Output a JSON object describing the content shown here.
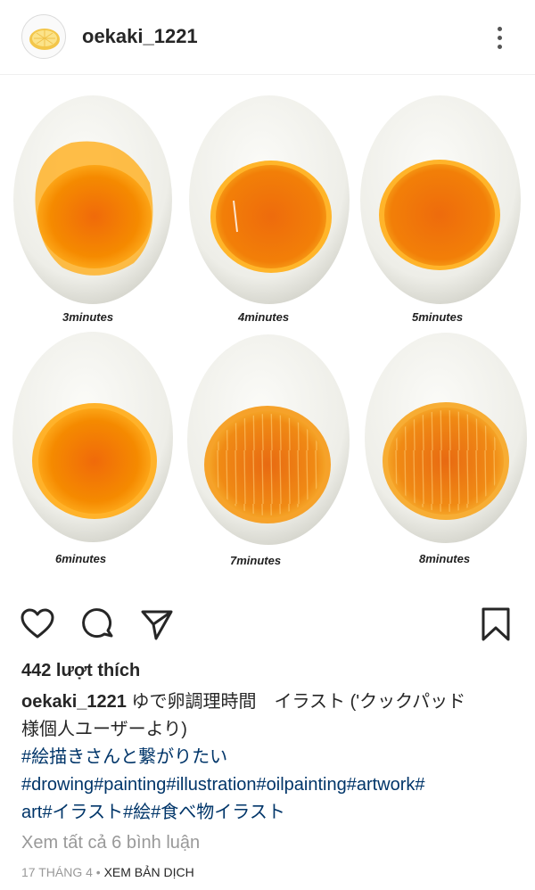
{
  "post": {
    "username": "oekaki_1221",
    "avatar_icon": "lemon-avatar-icon"
  },
  "image": {
    "labels": [
      "3minutes",
      "4minutes",
      "5minutes",
      "6minutes",
      "7minutes",
      "8minutes"
    ]
  },
  "actions": {
    "like_icon": "heart-icon",
    "comment_icon": "comment-icon",
    "share_icon": "send-icon",
    "save_icon": "bookmark-icon"
  },
  "likes": "442 lượt thích",
  "caption": {
    "user": "oekaki_1221",
    "line1_text": "ゆで卵調理時間　イラスト ('クックパッド",
    "line2": "様個人ユーザーより)",
    "line3": "#絵描きさんと繋がりたい",
    "line4": "#drowing#painting#illustration#oilpainting#artwork#",
    "line5": "art#イラスト#絵#食べ物イラスト"
  },
  "comments_link": "Xem tất cả 6 bình luận",
  "footer": {
    "date": "17 THÁNG 4",
    "separator": " • ",
    "translate": "XEM BẢN DỊCH"
  },
  "colors": {
    "hashtag": "#003569",
    "muted": "#999999",
    "yolk_outer": "#ff9a00",
    "yolk_inner": "#f06a0a"
  }
}
